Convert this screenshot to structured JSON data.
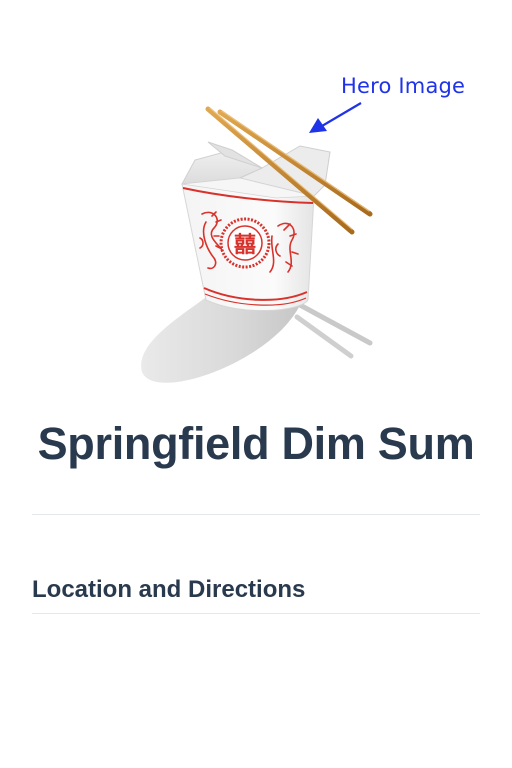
{
  "annotation": {
    "label": "Hero Image"
  },
  "hero": {
    "image_name": "takeout-box-with-chopsticks",
    "box_glyph": "囍"
  },
  "header": {
    "title": "Springfield Dim Sum"
  },
  "sections": [
    {
      "heading": "Location and Directions"
    }
  ],
  "colors": {
    "title": "#2a3a4e",
    "annotation": "#1f33e8",
    "box_accent": "#d8322c",
    "chopsticks": "#c8892e",
    "divider": "#e5e7eb"
  }
}
